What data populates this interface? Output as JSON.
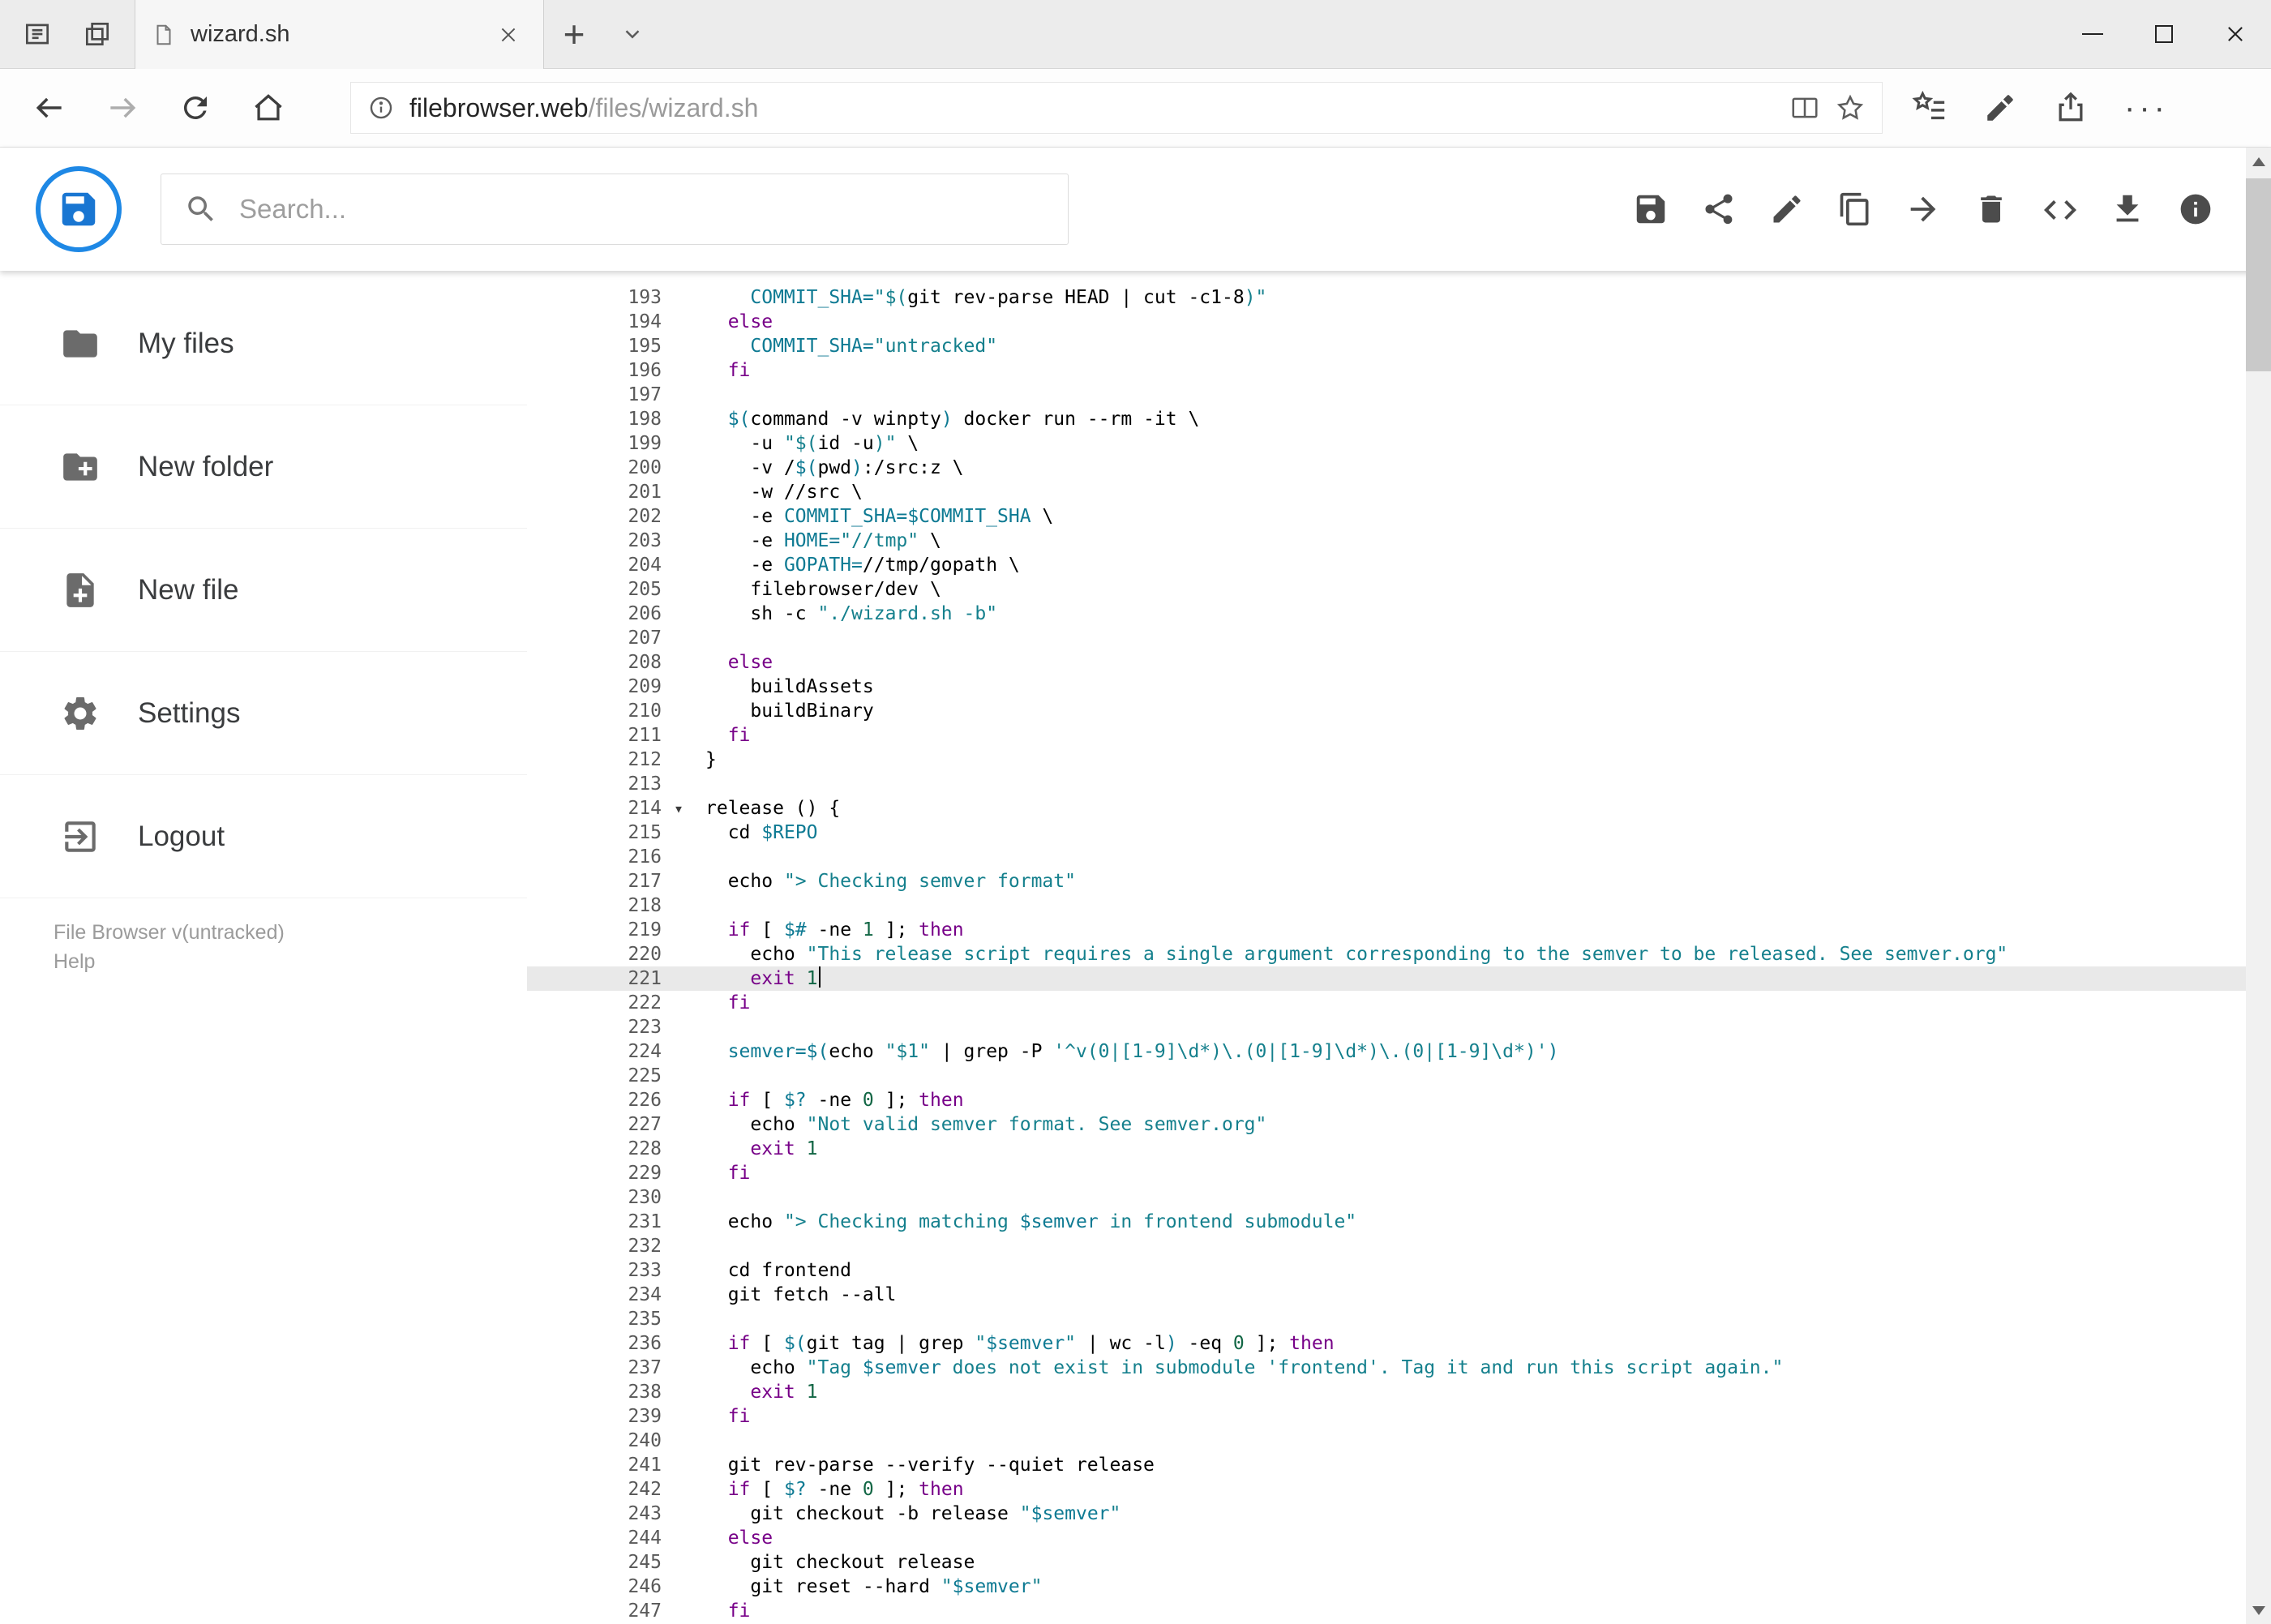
{
  "colors": {
    "accent_blue": "#1e88e5",
    "logo_blue": "#1976d2",
    "keyword": "#770088",
    "string": "#15808d",
    "variable": "#0e7a93",
    "number": "#116644",
    "active_line": "#e9e9e9"
  },
  "icons": {
    "new_tab": "+",
    "more_options": "···",
    "fold_marker": "▾"
  },
  "browser": {
    "tab_title": "wizard.sh",
    "url_domain": "filebrowser.web",
    "url_path": "/files/wizard.sh"
  },
  "app_header": {
    "search_placeholder": "Search..."
  },
  "sidebar": {
    "items": [
      {
        "label": "My files"
      },
      {
        "label": "New folder"
      },
      {
        "label": "New file"
      },
      {
        "label": "Settings"
      },
      {
        "label": "Logout"
      }
    ],
    "footer_version": "File Browser v(untracked)",
    "footer_help": "Help"
  },
  "editor": {
    "active_line": 221,
    "cursor_line": 221,
    "fold_lines": [
      214
    ],
    "lines": [
      {
        "n": 193,
        "t": [
          [
            "p",
            "    "
          ],
          [
            "v",
            "COMMIT_SHA="
          ],
          [
            "s",
            "\"$("
          ],
          [
            "p",
            "git rev-parse HEAD | cut -c1-8"
          ],
          [
            "s",
            ")\""
          ]
        ]
      },
      {
        "n": 194,
        "t": [
          [
            "p",
            "  "
          ],
          [
            "k",
            "else"
          ]
        ]
      },
      {
        "n": 195,
        "t": [
          [
            "p",
            "    "
          ],
          [
            "v",
            "COMMIT_SHA="
          ],
          [
            "s",
            "\"untracked\""
          ]
        ]
      },
      {
        "n": 196,
        "t": [
          [
            "p",
            "  "
          ],
          [
            "k",
            "fi"
          ]
        ]
      },
      {
        "n": 197,
        "t": []
      },
      {
        "n": 198,
        "t": [
          [
            "p",
            "  "
          ],
          [
            "v",
            "$("
          ],
          [
            "p",
            "command -v winpty"
          ],
          [
            "v",
            ")"
          ],
          [
            "p",
            " docker run --rm -it \\"
          ]
        ]
      },
      {
        "n": 199,
        "t": [
          [
            "p",
            "    -u "
          ],
          [
            "s",
            "\"$("
          ],
          [
            "p",
            "id -u"
          ],
          [
            "s",
            ")\""
          ],
          [
            "p",
            " \\"
          ]
        ]
      },
      {
        "n": 200,
        "t": [
          [
            "p",
            "    -v /"
          ],
          [
            "v",
            "$("
          ],
          [
            "p",
            "pwd"
          ],
          [
            "v",
            ")"
          ],
          [
            "p",
            ":/src:z \\"
          ]
        ]
      },
      {
        "n": 201,
        "t": [
          [
            "p",
            "    -w //src \\"
          ]
        ]
      },
      {
        "n": 202,
        "t": [
          [
            "p",
            "    -e "
          ],
          [
            "v",
            "COMMIT_SHA=$COMMIT_SHA"
          ],
          [
            "p",
            " \\"
          ]
        ]
      },
      {
        "n": 203,
        "t": [
          [
            "p",
            "    -e "
          ],
          [
            "v",
            "HOME="
          ],
          [
            "s",
            "\"//tmp\""
          ],
          [
            "p",
            " \\"
          ]
        ]
      },
      {
        "n": 204,
        "t": [
          [
            "p",
            "    -e "
          ],
          [
            "v",
            "GOPATH="
          ],
          [
            "p",
            "//tmp/gopath \\"
          ]
        ]
      },
      {
        "n": 205,
        "t": [
          [
            "p",
            "    filebrowser/dev \\"
          ]
        ]
      },
      {
        "n": 206,
        "t": [
          [
            "p",
            "    sh -c "
          ],
          [
            "s",
            "\"./wizard.sh -b\""
          ]
        ]
      },
      {
        "n": 207,
        "t": []
      },
      {
        "n": 208,
        "t": [
          [
            "p",
            "  "
          ],
          [
            "k",
            "else"
          ]
        ]
      },
      {
        "n": 209,
        "t": [
          [
            "p",
            "    buildAssets"
          ]
        ]
      },
      {
        "n": 210,
        "t": [
          [
            "p",
            "    buildBinary"
          ]
        ]
      },
      {
        "n": 211,
        "t": [
          [
            "p",
            "  "
          ],
          [
            "k",
            "fi"
          ]
        ]
      },
      {
        "n": 212,
        "t": [
          [
            "p",
            "}"
          ]
        ]
      },
      {
        "n": 213,
        "t": []
      },
      {
        "n": 214,
        "t": [
          [
            "p",
            "release () {"
          ]
        ]
      },
      {
        "n": 215,
        "t": [
          [
            "p",
            "  cd "
          ],
          [
            "v",
            "$REPO"
          ]
        ]
      },
      {
        "n": 216,
        "t": []
      },
      {
        "n": 217,
        "t": [
          [
            "p",
            "  echo "
          ],
          [
            "s",
            "\"> Checking semver format\""
          ]
        ]
      },
      {
        "n": 218,
        "t": []
      },
      {
        "n": 219,
        "t": [
          [
            "p",
            "  "
          ],
          [
            "k",
            "if"
          ],
          [
            "p",
            " [ "
          ],
          [
            "v",
            "$#"
          ],
          [
            "p",
            " -ne "
          ],
          [
            "n2",
            "1"
          ],
          [
            "p",
            " ]; "
          ],
          [
            "k",
            "then"
          ]
        ]
      },
      {
        "n": 220,
        "t": [
          [
            "p",
            "    echo "
          ],
          [
            "s",
            "\"This release script requires a single argument corresponding to the semver to be released. See semver.org\""
          ]
        ]
      },
      {
        "n": 221,
        "t": [
          [
            "p",
            "    "
          ],
          [
            "k",
            "exit"
          ],
          [
            "p",
            " "
          ],
          [
            "n2",
            "1"
          ]
        ]
      },
      {
        "n": 222,
        "t": [
          [
            "p",
            "  "
          ],
          [
            "k",
            "fi"
          ]
        ]
      },
      {
        "n": 223,
        "t": []
      },
      {
        "n": 224,
        "t": [
          [
            "p",
            "  "
          ],
          [
            "v",
            "semver=$("
          ],
          [
            "p",
            "echo "
          ],
          [
            "s",
            "\"$1\""
          ],
          [
            "p",
            " | grep -P "
          ],
          [
            "s",
            "'^v(0|[1-9]\\d*)\\.(0|[1-9]\\d*)\\.(0|[1-9]\\d*)'"
          ],
          [
            "v",
            ")"
          ]
        ]
      },
      {
        "n": 225,
        "t": []
      },
      {
        "n": 226,
        "t": [
          [
            "p",
            "  "
          ],
          [
            "k",
            "if"
          ],
          [
            "p",
            " [ "
          ],
          [
            "v",
            "$?"
          ],
          [
            "p",
            " -ne "
          ],
          [
            "n2",
            "0"
          ],
          [
            "p",
            " ]; "
          ],
          [
            "k",
            "then"
          ]
        ]
      },
      {
        "n": 227,
        "t": [
          [
            "p",
            "    echo "
          ],
          [
            "s",
            "\"Not valid semver format. See semver.org\""
          ]
        ]
      },
      {
        "n": 228,
        "t": [
          [
            "p",
            "    "
          ],
          [
            "k",
            "exit"
          ],
          [
            "p",
            " "
          ],
          [
            "n2",
            "1"
          ]
        ]
      },
      {
        "n": 229,
        "t": [
          [
            "p",
            "  "
          ],
          [
            "k",
            "fi"
          ]
        ]
      },
      {
        "n": 230,
        "t": []
      },
      {
        "n": 231,
        "t": [
          [
            "p",
            "  echo "
          ],
          [
            "s",
            "\"> Checking matching "
          ],
          [
            "v",
            "$semver"
          ],
          [
            "s",
            " in frontend submodule\""
          ]
        ]
      },
      {
        "n": 232,
        "t": []
      },
      {
        "n": 233,
        "t": [
          [
            "p",
            "  cd frontend"
          ]
        ]
      },
      {
        "n": 234,
        "t": [
          [
            "p",
            "  git fetch --all"
          ]
        ]
      },
      {
        "n": 235,
        "t": []
      },
      {
        "n": 236,
        "t": [
          [
            "p",
            "  "
          ],
          [
            "k",
            "if"
          ],
          [
            "p",
            " [ "
          ],
          [
            "v",
            "$("
          ],
          [
            "p",
            "git tag | grep "
          ],
          [
            "s",
            "\""
          ],
          [
            "v",
            "$semver"
          ],
          [
            "s",
            "\""
          ],
          [
            "p",
            " | wc -l"
          ],
          [
            "v",
            ")"
          ],
          [
            "p",
            " -eq "
          ],
          [
            "n2",
            "0"
          ],
          [
            "p",
            " ]; "
          ],
          [
            "k",
            "then"
          ]
        ]
      },
      {
        "n": 237,
        "t": [
          [
            "p",
            "    echo "
          ],
          [
            "s",
            "\"Tag "
          ],
          [
            "v",
            "$semver"
          ],
          [
            "s",
            " does not exist in submodule 'frontend'. Tag it and run this script again.\""
          ]
        ]
      },
      {
        "n": 238,
        "t": [
          [
            "p",
            "    "
          ],
          [
            "k",
            "exit"
          ],
          [
            "p",
            " "
          ],
          [
            "n2",
            "1"
          ]
        ]
      },
      {
        "n": 239,
        "t": [
          [
            "p",
            "  "
          ],
          [
            "k",
            "fi"
          ]
        ]
      },
      {
        "n": 240,
        "t": []
      },
      {
        "n": 241,
        "t": [
          [
            "p",
            "  git rev-parse --verify --quiet release"
          ]
        ]
      },
      {
        "n": 242,
        "t": [
          [
            "p",
            "  "
          ],
          [
            "k",
            "if"
          ],
          [
            "p",
            " [ "
          ],
          [
            "v",
            "$?"
          ],
          [
            "p",
            " -ne "
          ],
          [
            "n2",
            "0"
          ],
          [
            "p",
            " ]; "
          ],
          [
            "k",
            "then"
          ]
        ]
      },
      {
        "n": 243,
        "t": [
          [
            "p",
            "    git checkout -b release "
          ],
          [
            "s",
            "\""
          ],
          [
            "v",
            "$semver"
          ],
          [
            "s",
            "\""
          ]
        ]
      },
      {
        "n": 244,
        "t": [
          [
            "p",
            "  "
          ],
          [
            "k",
            "else"
          ]
        ]
      },
      {
        "n": 245,
        "t": [
          [
            "p",
            "    git checkout release"
          ]
        ]
      },
      {
        "n": 246,
        "t": [
          [
            "p",
            "    git reset --hard "
          ],
          [
            "s",
            "\""
          ],
          [
            "v",
            "$semver"
          ],
          [
            "s",
            "\""
          ]
        ]
      },
      {
        "n": 247,
        "t": [
          [
            "p",
            "  "
          ],
          [
            "k",
            "fi"
          ]
        ]
      }
    ]
  }
}
